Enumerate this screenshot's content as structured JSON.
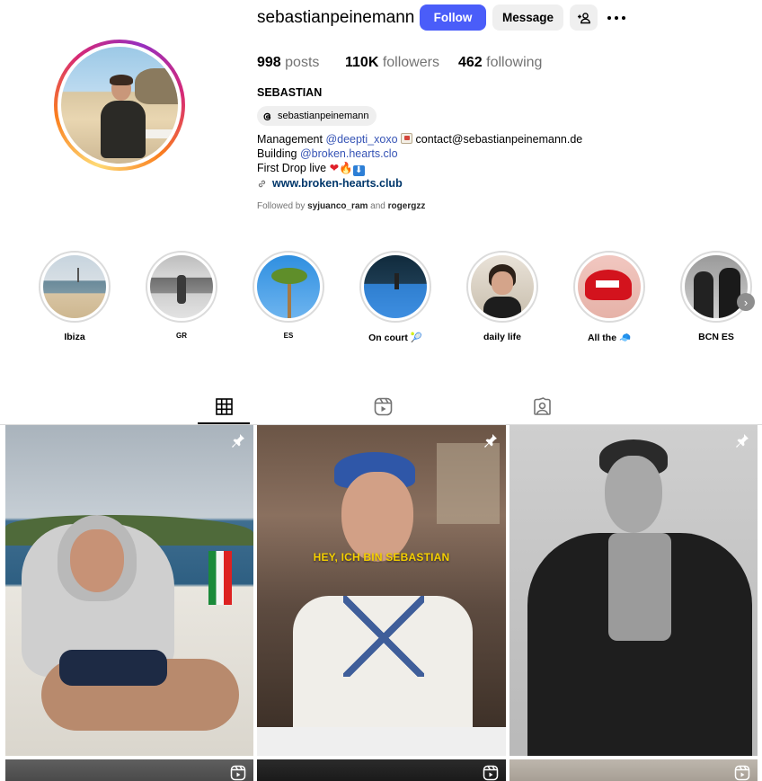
{
  "profile": {
    "username": "sebastianpeinemann",
    "full_name": "SEBASTIAN",
    "threads_handle": "sebastianpeinemann",
    "buttons": {
      "follow": "Follow",
      "message": "Message"
    },
    "stats": {
      "posts_count": "998",
      "posts_label": "posts",
      "followers_count": "110K",
      "followers_label": "followers",
      "following_count": "462",
      "following_label": "following"
    },
    "bio": {
      "line1_prefix": "Management ",
      "line1_mention": "@deepti_xoxo",
      "line1_suffix": " contact@sebastianpeinemann.de",
      "line2_prefix": "Building ",
      "line2_mention": "@broken.hearts.clo",
      "line3": "First Drop live ",
      "link": "www.broken-hearts.club"
    },
    "followed_by": {
      "prefix": "Followed by ",
      "user1": "syjuanco_ram",
      "and": " and ",
      "user2": "rogergzz"
    }
  },
  "highlights": [
    {
      "label": "Ibiza"
    },
    {
      "label": "GR"
    },
    {
      "label": "ES"
    },
    {
      "label": "On court 🎾"
    },
    {
      "label": "daily life"
    },
    {
      "label": "All the 🧢"
    },
    {
      "label": "BCN ES"
    }
  ],
  "tabs": [
    {
      "name": "posts",
      "icon": "grid-icon",
      "active": true
    },
    {
      "name": "reels",
      "icon": "reels-icon",
      "active": false
    },
    {
      "name": "tagged",
      "icon": "tagged-icon",
      "active": false
    }
  ],
  "posts": [
    {
      "type": "pinned"
    },
    {
      "type": "pinned",
      "overlay_text": "HEY, ICH BIN SEBASTIAN"
    },
    {
      "type": "pinned"
    },
    {
      "type": "reel"
    },
    {
      "type": "reel"
    },
    {
      "type": "reel"
    }
  ],
  "colors": {
    "follow_button": "#4a5df9",
    "link": "#00376b",
    "mention": "#3553b5",
    "secondary_text": "#737373"
  }
}
